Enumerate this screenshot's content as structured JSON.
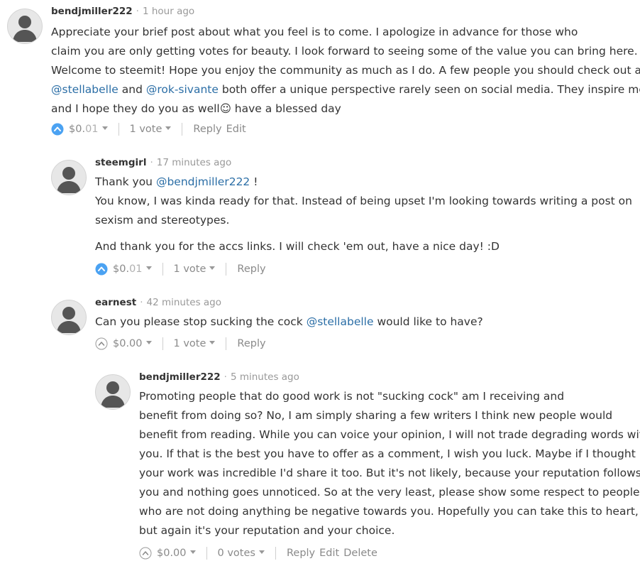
{
  "comments": [
    {
      "author": "bendjmiller222",
      "age": "1 hour ago",
      "paragraphs": [
        [
          [
            {
              "t": "Appreciate your brief post about what you feel is to come. I apologize in advance for those who"
            }
          ],
          [
            {
              "t": "claim you are only getting votes for beauty. I look forward to seeing some of the value you can bring here."
            }
          ],
          [
            {
              "t": "Welcome to steemit! Hope you enjoy the community as much as I do. A few people you should check out are"
            }
          ],
          [
            {
              "t": "@stellabelle",
              "mention": true
            },
            {
              "t": " and "
            },
            {
              "t": "@rok-sivante",
              "mention": true
            },
            {
              "t": " both offer a unique perspective rarely seen on social media. They inspire me"
            }
          ],
          [
            {
              "t": "and I hope they do you as well☺ have a blessed day"
            }
          ]
        ]
      ],
      "voted": true,
      "payout_main": "$0.",
      "payout_cents": "01",
      "votes": "1 vote",
      "actions": [
        "Reply",
        "Edit"
      ]
    },
    {
      "author": "steemgirl",
      "age": "17 minutes ago",
      "paragraphs": [
        [
          [
            {
              "t": "Thank you "
            },
            {
              "t": "@bendjmiller222",
              "mention": true
            },
            {
              "t": " !"
            }
          ],
          [
            {
              "t": "You know, I was kinda ready for that. Instead of being upset I'm looking towards writing a post on"
            }
          ],
          [
            {
              "t": "sexism and stereotypes."
            }
          ]
        ],
        [
          [
            {
              "t": "And thank you for the accs links. I will check 'em out, have a nice day! :D"
            }
          ]
        ]
      ],
      "voted": true,
      "payout_main": "$0.",
      "payout_cents": "01",
      "votes": "1 vote",
      "actions": [
        "Reply"
      ]
    },
    {
      "author": "earnest",
      "age": "42 minutes ago",
      "paragraphs": [
        [
          [
            {
              "t": "Can you please stop sucking the cock "
            },
            {
              "t": "@stellabelle",
              "mention": true
            },
            {
              "t": " would like to have?"
            }
          ]
        ]
      ],
      "voted": false,
      "payout_main": "$0.00",
      "payout_cents": "",
      "votes": "1 vote",
      "actions": [
        "Reply"
      ]
    },
    {
      "author": "bendjmiller222",
      "age": "5 minutes ago",
      "paragraphs": [
        [
          [
            {
              "t": "Promoting people that do good work is not \"sucking cock\" am I receiving and"
            }
          ],
          [
            {
              "t": "benefit from doing so? No, I am simply sharing a few writers I think new people would"
            }
          ],
          [
            {
              "t": "benefit from reading. While you can voice your opinion, I will not trade degrading words with"
            }
          ],
          [
            {
              "t": "you. If that is the best you have to offer as a comment, I wish you luck. Maybe if I thought"
            }
          ],
          [
            {
              "t": "your work was incredible I'd share it too. But it's not likely, because your reputation follows"
            }
          ],
          [
            {
              "t": "you and nothing goes unnoticed. So at the very least, please show some respect to people"
            }
          ],
          [
            {
              "t": "who are not doing anything be negative towards you. Hopefully you can take this to heart,"
            }
          ],
          [
            {
              "t": "but again it's your reputation and your choice."
            }
          ]
        ]
      ],
      "voted": false,
      "payout_main": "$0.00",
      "payout_cents": "",
      "votes": "0 votes",
      "actions": [
        "Reply",
        "Edit",
        "Delete"
      ]
    }
  ],
  "colors": {
    "upvote_active": "#4ba2f2",
    "mention": "#2b6ea6",
    "muted": "#8a8a8a"
  },
  "icons": {
    "avatar": "user-silhouette-icon",
    "upvote": "chevron-up-circle-icon",
    "dropdown": "caret-down-icon"
  }
}
